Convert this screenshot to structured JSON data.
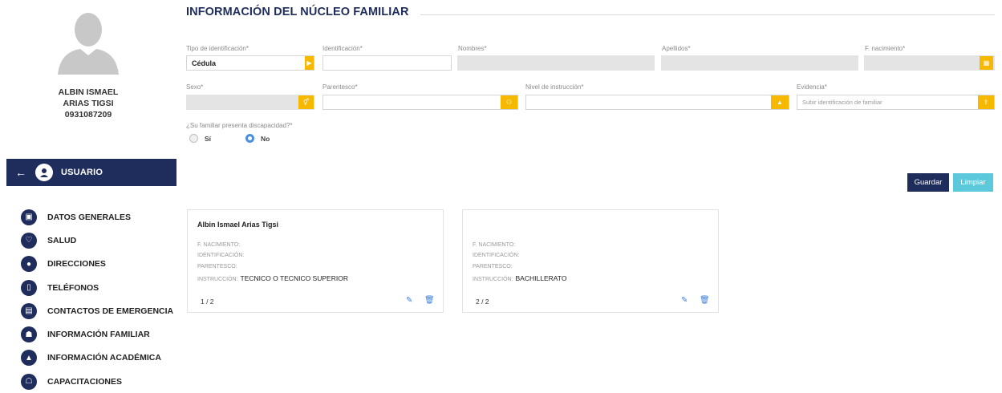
{
  "user": {
    "first_names": "ALBIN ISMAEL",
    "last_names": "ARIAS TIGSI",
    "id_number": "0931087209"
  },
  "sidebar": {
    "section_label": "USUARIO",
    "items": [
      {
        "label": "DATOS GENERALES",
        "icon": "id-card-icon"
      },
      {
        "label": "SALUD",
        "icon": "heart-icon"
      },
      {
        "label": "DIRECCIONES",
        "icon": "location-icon"
      },
      {
        "label": "TELÉFONOS",
        "icon": "phone-icon"
      },
      {
        "label": "CONTACTOS DE EMERGENCIA",
        "icon": "contacts-icon"
      },
      {
        "label": "INFORMACIÓN FAMILIAR",
        "icon": "family-icon"
      },
      {
        "label": "INFORMACIÓN ACADÉMICA",
        "icon": "graduation-icon"
      },
      {
        "label": "CAPACITACIONES",
        "icon": "training-icon"
      }
    ]
  },
  "form": {
    "title": "INFORMACIÓN DEL NÚCLEO FAMILIAR",
    "tipo_id_label": "Tipo de identificación*",
    "tipo_id_value": "Cédula",
    "identificacion_label": "Identificación*",
    "nombres_label": "Nombres*",
    "apellidos_label": "Apellidos*",
    "f_nacimiento_label": "F. nacimiento*",
    "sexo_label": "Sexo*",
    "parentesco_label": "Parentesco*",
    "nivel_label": "Nivel de instrucción*",
    "evidencia_label": "Evidencia*",
    "evidencia_placeholder": "Subir identificación de familiar",
    "discapacidad_label": "¿Su familiar presenta discapacidad?*",
    "opt_si": "Sí",
    "opt_no": "No",
    "selected": "No",
    "guardar": "Guardar",
    "limpiar": "Limpiar"
  },
  "cards": [
    {
      "name": "Albin Ismael Arias Tigsi",
      "f_nac_label": "F. NACIMIENTO:",
      "ident_label": "IDENTIFICACIÓN:",
      "paren_label": "PARENTESCO:",
      "instr_label": "INSTRUCCIÓN:",
      "instruccion": "TECNICO O TECNICO SUPERIOR",
      "page": "1 / 2"
    },
    {
      "name": "",
      "f_nac_label": "F. NACIMIENTO:",
      "ident_label": "IDENTIFICACIÓN:",
      "paren_label": "PARENTESCO:",
      "instr_label": "INSTRUCCIÓN:",
      "instruccion": "BACHILLERATO",
      "page": "2 / 2"
    }
  ],
  "colors": {
    "navy": "#1f2d5c",
    "accent": "#f6b900",
    "blue": "#3b7de0",
    "light_blue": "#5bc8dc"
  }
}
